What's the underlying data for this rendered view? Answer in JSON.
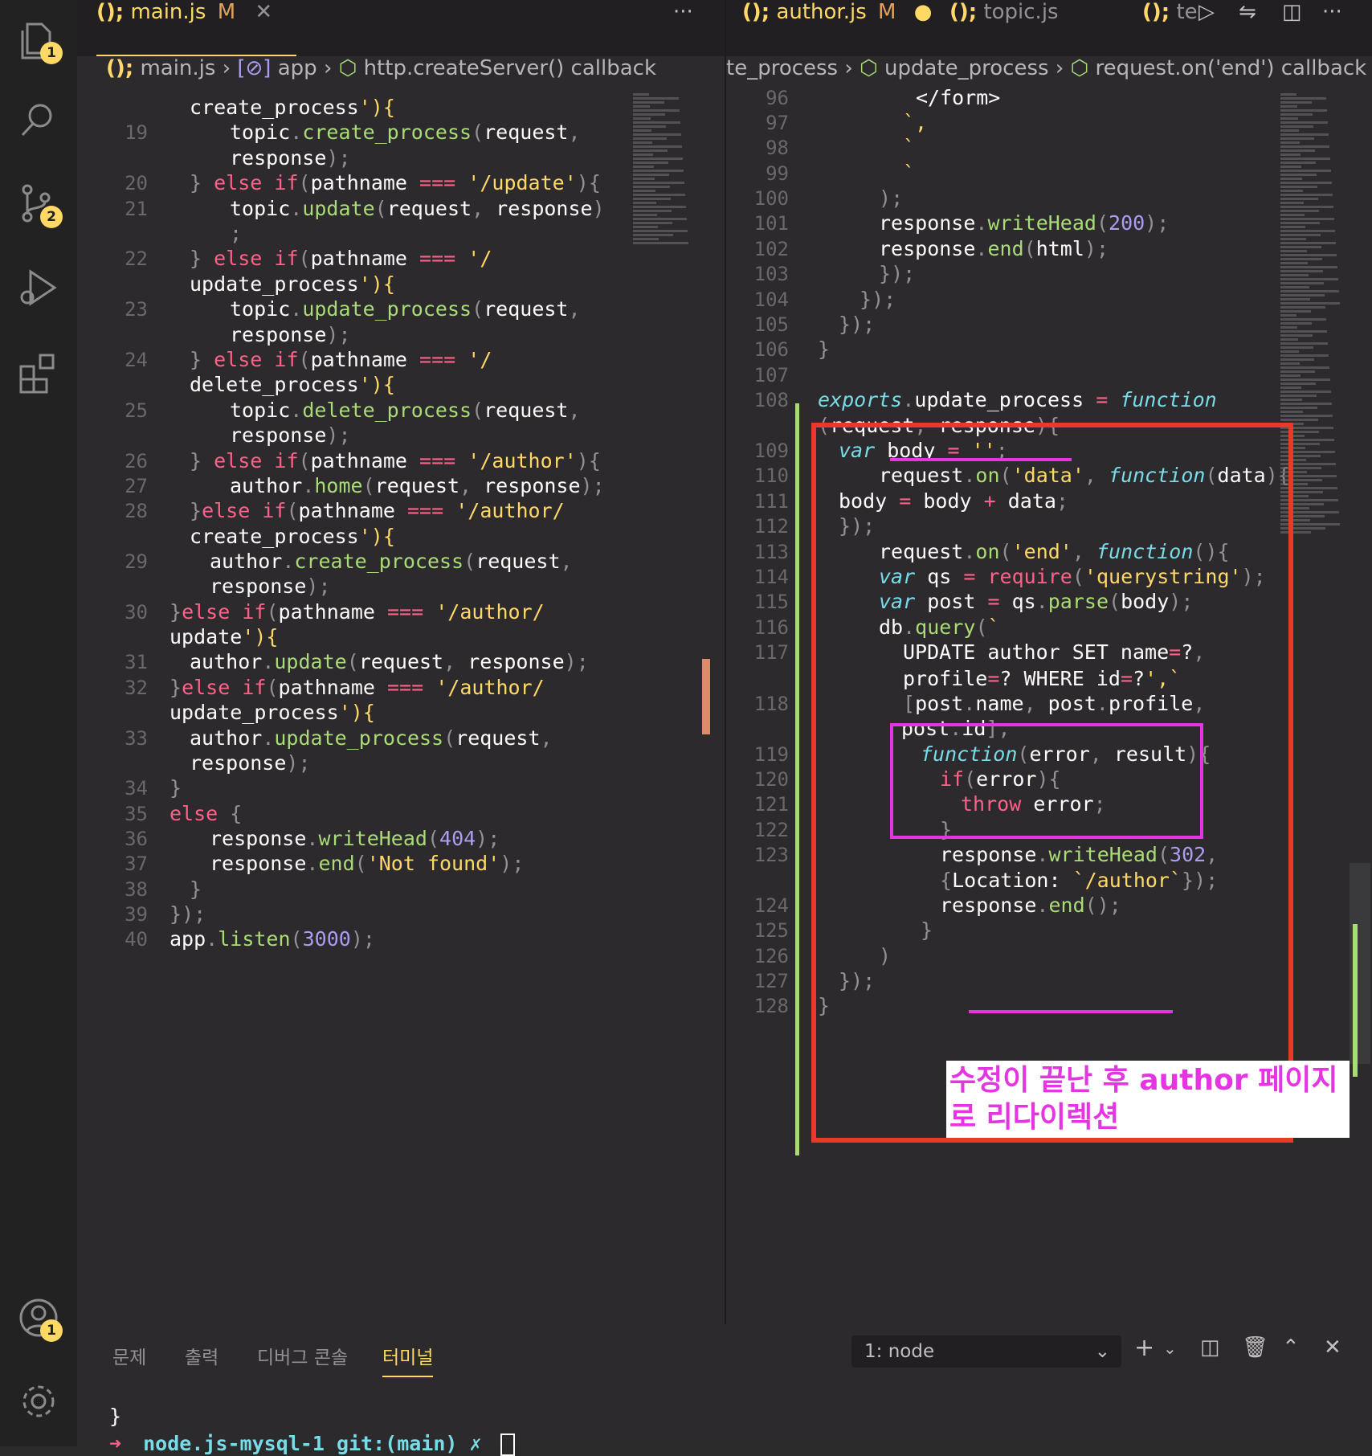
{
  "activity": {
    "explorer_badge": "1",
    "scm_badge": "2",
    "account_badge": "1",
    "icons": [
      "files-icon",
      "search-icon",
      "source-control-icon",
      "run-debug-icon",
      "extensions-icon",
      "account-icon",
      "gear-icon"
    ]
  },
  "left_editor": {
    "tab": {
      "icon": "();",
      "name": "main.js",
      "status": "M"
    },
    "breadcrumb": [
      "main.js",
      "app",
      "http.createServer() callback"
    ],
    "lines": [
      {
        "n": "",
        "t": "create_process'){"
      },
      {
        "n": "19",
        "t": "topic.create_process(request,"
      },
      {
        "n": "",
        "t": "response);"
      },
      {
        "n": "20",
        "t": "} else if(pathname === '/update'){"
      },
      {
        "n": "21",
        "t": "topic.update(request, response)"
      },
      {
        "n": "",
        "t": ";"
      },
      {
        "n": "22",
        "t": "} else if(pathname === '/"
      },
      {
        "n": "",
        "t": "update_process'){"
      },
      {
        "n": "23",
        "t": "topic.update_process(request,"
      },
      {
        "n": "",
        "t": "response);"
      },
      {
        "n": "24",
        "t": "} else if(pathname === '/"
      },
      {
        "n": "",
        "t": "delete_process'){"
      },
      {
        "n": "25",
        "t": "topic.delete_process(request,"
      },
      {
        "n": "",
        "t": "response);"
      },
      {
        "n": "26",
        "t": "} else if(pathname === '/author'){"
      },
      {
        "n": "27",
        "t": "author.home(request, response);"
      },
      {
        "n": "28",
        "t": "}else if(pathname === '/author/"
      },
      {
        "n": "",
        "t": "create_process'){"
      },
      {
        "n": "29",
        "t": "author.create_process(request,"
      },
      {
        "n": "",
        "t": "response);"
      },
      {
        "n": "30",
        "t": "}else if(pathname === '/author/"
      },
      {
        "n": "",
        "t": "update'){"
      },
      {
        "n": "31",
        "t": "author.update(request, response);"
      },
      {
        "n": "32",
        "t": "}else if(pathname === '/author/"
      },
      {
        "n": "",
        "t": "update_process'){"
      },
      {
        "n": "33",
        "t": "author.update_process(request,"
      },
      {
        "n": "",
        "t": "response);"
      },
      {
        "n": "34",
        "t": "}"
      },
      {
        "n": "35",
        "t": "else {"
      },
      {
        "n": "36",
        "t": "response.writeHead(404);"
      },
      {
        "n": "37",
        "t": "response.end('Not found');"
      },
      {
        "n": "38",
        "t": "}"
      },
      {
        "n": "39",
        "t": "});"
      },
      {
        "n": "40",
        "t": "app.listen(3000);"
      }
    ]
  },
  "right_editor": {
    "tabs": [
      {
        "icon": "();",
        "name": "author.js",
        "status": "M"
      },
      {
        "icon": "();",
        "name": "topic.js"
      },
      {
        "icon": "();",
        "name": "te"
      }
    ],
    "breadcrumb": [
      "te_process",
      "update_process",
      "request.on('end') callback"
    ],
    "lines": [
      {
        "n": "96",
        "t": "</form>"
      },
      {
        "n": "97",
        "t": "`,"
      },
      {
        "n": "98",
        "t": "`"
      },
      {
        "n": "99",
        "t": "`"
      },
      {
        "n": "100",
        "t": ");"
      },
      {
        "n": "101",
        "t": "response.writeHead(200);"
      },
      {
        "n": "102",
        "t": "response.end(html);"
      },
      {
        "n": "103",
        "t": "});"
      },
      {
        "n": "104",
        "t": "});"
      },
      {
        "n": "105",
        "t": "});"
      },
      {
        "n": "106",
        "t": "}"
      },
      {
        "n": "107",
        "t": ""
      },
      {
        "n": "108",
        "t": "exports.update_process = function"
      },
      {
        "n": "",
        "t": "(request, response){"
      },
      {
        "n": "109",
        "t": "var body = '';"
      },
      {
        "n": "110",
        "t": "request.on('data', function(data){"
      },
      {
        "n": "111",
        "t": "body = body + data;"
      },
      {
        "n": "112",
        "t": "});"
      },
      {
        "n": "113",
        "t": "request.on('end', function(){"
      },
      {
        "n": "114",
        "t": "var qs = require('querystring');"
      },
      {
        "n": "115",
        "t": "var post = qs.parse(body);"
      },
      {
        "n": "116",
        "t": "db.query(`"
      },
      {
        "n": "117",
        "t": "UPDATE author SET name=?,"
      },
      {
        "n": "",
        "t": "profile=? WHERE id=?',`"
      },
      {
        "n": "118",
        "t": "[post.name, post.profile,"
      },
      {
        "n": "",
        "t": "post.id],"
      },
      {
        "n": "119",
        "t": "function(error, result){"
      },
      {
        "n": "120",
        "t": "if(error){"
      },
      {
        "n": "121",
        "t": "throw error;"
      },
      {
        "n": "122",
        "t": "}"
      },
      {
        "n": "123",
        "t": "response.writeHead(302,"
      },
      {
        "n": "",
        "t": "{Location: `/author`});"
      },
      {
        "n": "124",
        "t": "response.end();"
      },
      {
        "n": "125",
        "t": "}"
      },
      {
        "n": "126",
        "t": ")"
      },
      {
        "n": "127",
        "t": "});"
      },
      {
        "n": "128",
        "t": "}"
      }
    ],
    "annotation": "수정이 끝난 후 author 페이지\n로 리다이렉션"
  },
  "panel": {
    "tabs": [
      "문제",
      "출력",
      "디버그 콘솔",
      "터미널"
    ],
    "active_tab": "터미널",
    "terminal_select": "1: node",
    "terminal_lines": [
      "}",
      "node.js-mysql-1 git:(main) ✗"
    ]
  },
  "colors": {
    "annotation_red": "#e8392b",
    "annotation_magenta": "#e535e0",
    "accent_yellow": "#ffd866"
  }
}
